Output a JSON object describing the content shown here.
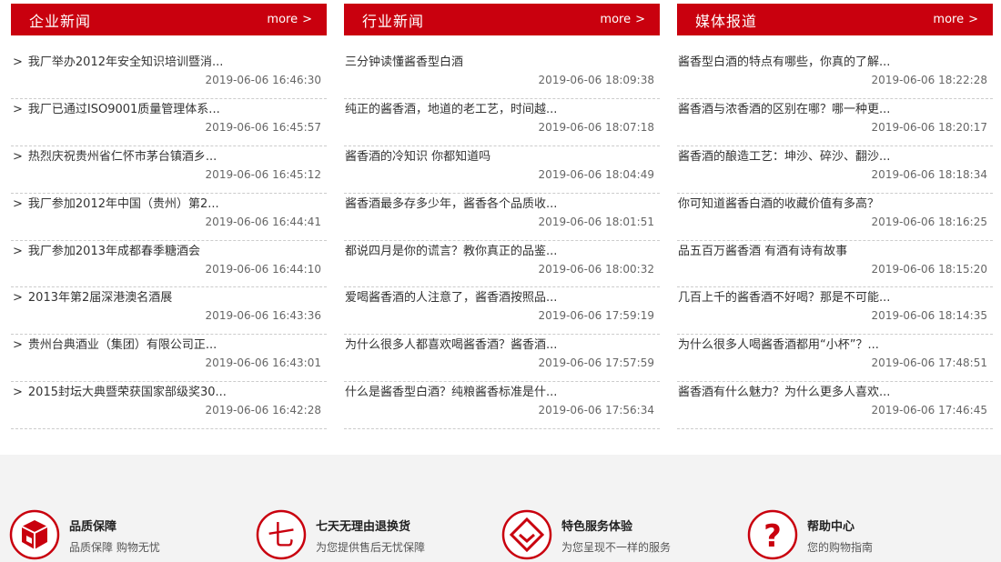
{
  "columns": [
    {
      "title": "企业新闻",
      "more": "more",
      "items": [
        {
          "title": "我厂举办2012年安全知识培训暨消...",
          "date": "2019-06-06 16:46:30"
        },
        {
          "title": "我厂已通过ISO9001质量管理体系...",
          "date": "2019-06-06 16:45:57"
        },
        {
          "title": "热烈庆祝贵州省仁怀市茅台镇酒乡...",
          "date": "2019-06-06 16:45:12"
        },
        {
          "title": "我厂参加2012年中国（贵州）第2...",
          "date": "2019-06-06 16:44:41"
        },
        {
          "title": "我厂参加2013年成都春季糖酒会",
          "date": "2019-06-06 16:44:10"
        },
        {
          "title": "2013年第2届深港澳名酒展",
          "date": "2019-06-06 16:43:36"
        },
        {
          "title": "贵州台典酒业（集团）有限公司正...",
          "date": "2019-06-06 16:43:01"
        },
        {
          "title": "2015封坛大典暨荣获国家部级奖30...",
          "date": "2019-06-06 16:42:28"
        }
      ]
    },
    {
      "title": "行业新闻",
      "more": "more",
      "items": [
        {
          "title": "三分钟读懂酱香型白酒",
          "date": "2019-06-06 18:09:38"
        },
        {
          "title": "纯正的酱香酒，地道的老工艺，时间越...",
          "date": "2019-06-06 18:07:18"
        },
        {
          "title": "酱香酒的冷知识 你都知道吗",
          "date": "2019-06-06 18:04:49"
        },
        {
          "title": "酱香酒最多存多少年，酱香各个品质收...",
          "date": "2019-06-06 18:01:51"
        },
        {
          "title": "都说四月是你的谎言？教你真正的品鉴...",
          "date": "2019-06-06 18:00:32"
        },
        {
          "title": "爱喝酱香酒的人注意了，酱香酒按照品...",
          "date": "2019-06-06 17:59:19"
        },
        {
          "title": "为什么很多人都喜欢喝酱香酒？酱香酒...",
          "date": "2019-06-06 17:57:59"
        },
        {
          "title": "什么是酱香型白酒？纯粮酱香标准是什...",
          "date": "2019-06-06 17:56:34"
        }
      ]
    },
    {
      "title": "媒体报道",
      "more": "more",
      "items": [
        {
          "title": "酱香型白酒的特点有哪些，你真的了解...",
          "date": "2019-06-06 18:22:28"
        },
        {
          "title": "酱香酒与浓香酒的区别在哪？哪一种更...",
          "date": "2019-06-06 18:20:17"
        },
        {
          "title": "酱香酒的酿造工艺：坤沙、碎沙、翻沙...",
          "date": "2019-06-06 18:18:34"
        },
        {
          "title": "你可知道酱香白酒的收藏价值有多高？",
          "date": "2019-06-06 18:16:25"
        },
        {
          "title": "品五百万酱香酒 有酒有诗有故事",
          "date": "2019-06-06 18:15:20"
        },
        {
          "title": "几百上千的酱香酒不好喝？那是不可能...",
          "date": "2019-06-06 18:14:35"
        },
        {
          "title": "为什么很多人喝酱香酒都用“小杯”？...",
          "date": "2019-06-06 17:48:51"
        },
        {
          "title": "酱香酒有什么魅力？为什么更多人喜欢...",
          "date": "2019-06-06 17:46:45"
        }
      ]
    }
  ],
  "services": [
    {
      "icon": "cube-icon",
      "title": "品质保障",
      "sub": "品质保障 购物无忧"
    },
    {
      "icon": "seven-icon",
      "title": "七天无理由退换货",
      "glyph": "七",
      "sub": "为您提供售后无忧保障"
    },
    {
      "icon": "diamond-icon",
      "title": "特色服务体验",
      "sub": "为您呈现不一样的服务"
    },
    {
      "icon": "question-icon",
      "title": "帮助中心",
      "glyph": "?",
      "sub": "您的购物指南"
    }
  ],
  "colors": {
    "brand_red": "#c9000e",
    "footer_bg": "#f3f3f3"
  }
}
